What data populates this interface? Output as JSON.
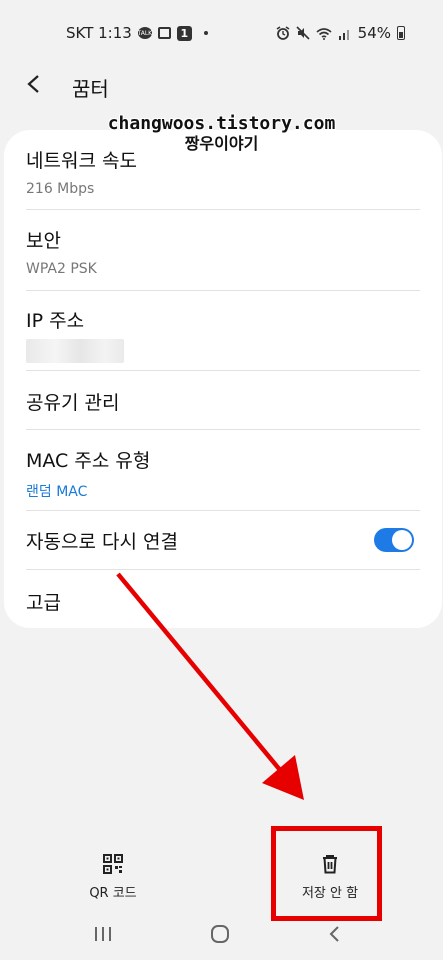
{
  "status_bar": {
    "carrier_time": "SKT 1:13",
    "battery": "54%",
    "badge_text": "1",
    "bubble_text": "TALK"
  },
  "header": {
    "title": "꿈터"
  },
  "watermark": {
    "line1": "changwoos.tistory.com",
    "line2": "짱우이야기"
  },
  "settings": [
    {
      "label": "네트워크 속도",
      "sub": "216 Mbps"
    },
    {
      "label": "보안",
      "sub": "WPA2 PSK"
    },
    {
      "label": "IP 주소"
    },
    {
      "label": "공유기 관리"
    },
    {
      "label": "MAC 주소 유형",
      "sub": "랜덤 MAC"
    },
    {
      "label": "자동으로 다시 연결",
      "toggle_on": true
    },
    {
      "label": "고급"
    }
  ],
  "bottom_actions": {
    "qr_label": "QR 코드",
    "forget_label": "저장 안 함"
  },
  "colors": {
    "accent": "#1e7be6",
    "annotation_red": "#e60000",
    "background": "#f2f2f2"
  }
}
